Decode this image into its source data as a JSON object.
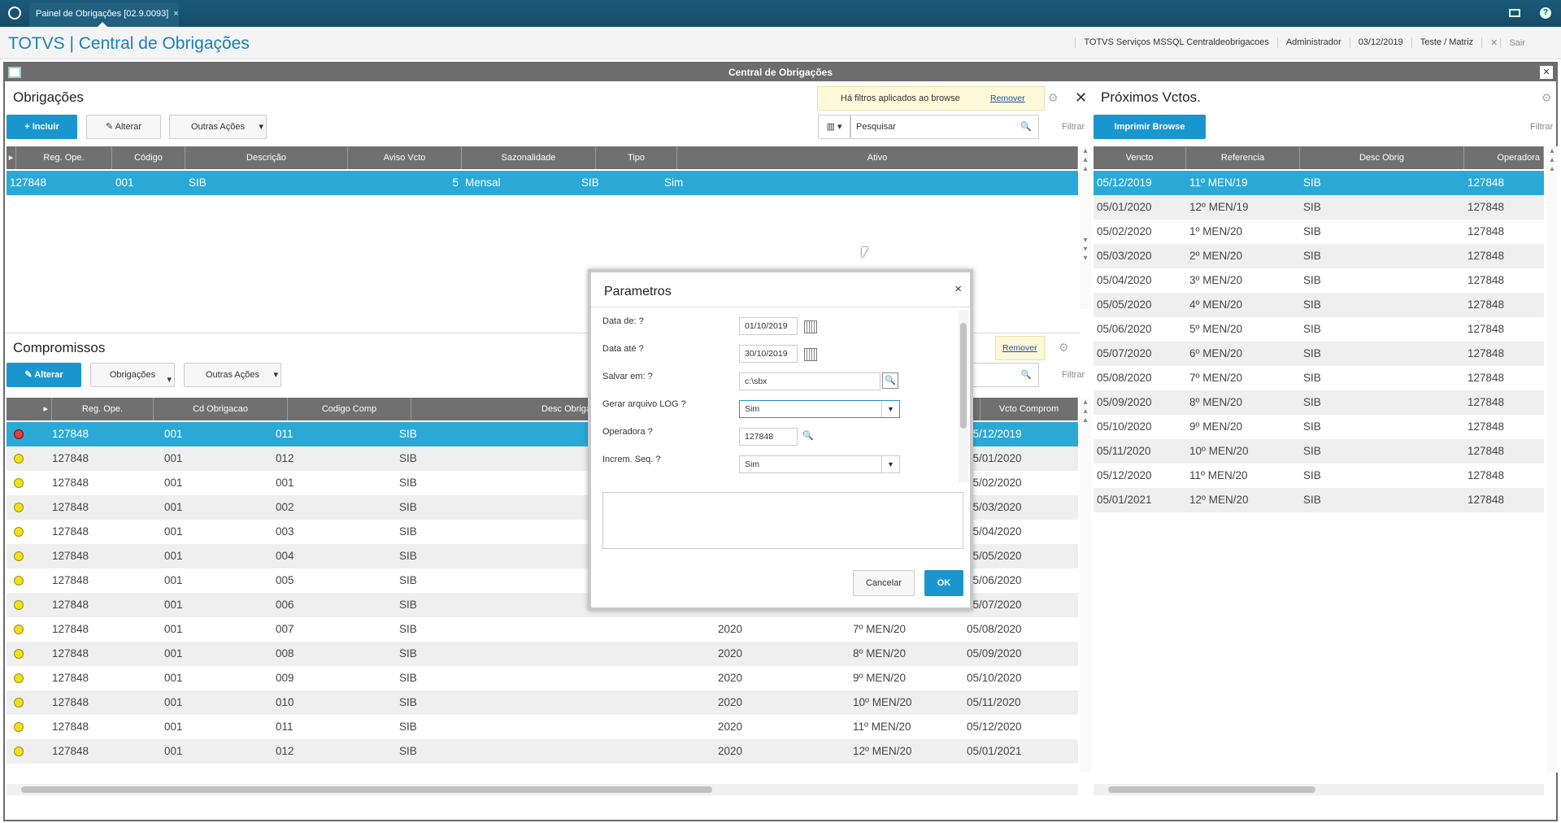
{
  "topbar": {
    "tab_label": "Painel de Obrigações [02.9.0093]",
    "tab_close": "×"
  },
  "header": {
    "app_title": "TOTVS | Central de Obrigações",
    "info": [
      "TOTVS Serviços MSSQL Centraldeobrigacoes",
      "Administrador",
      "03/12/2019",
      "Teste / Matriz"
    ],
    "exit": "Sair"
  },
  "window": {
    "title": "Central de Obrigações"
  },
  "obrigacoes": {
    "title": "Obrigações",
    "filter_msg": "Há filtros aplicados ao browse",
    "remove": "Remover",
    "btn_incluir": "Incluir",
    "btn_alterar": "Alterar",
    "btn_outras": "Outras Ações",
    "search_placeholder": "Pesquisar",
    "filtrar": "Filtrar",
    "columns": [
      "Reg. Ope.",
      "Código",
      "Descrição",
      "Aviso Vcto",
      "Sazonalidade",
      "Tipo",
      "Ativo"
    ],
    "rows": [
      [
        "127848",
        "001",
        "SIB",
        "5",
        "Mensal",
        "SIB",
        "Sim"
      ]
    ]
  },
  "compromissos": {
    "title": "Compromissos",
    "remove": "Remover",
    "btn_alterar": "Alterar",
    "btn_obrig": "Obrigações",
    "btn_outras": "Outras Ações",
    "filtrar": "Filtrar",
    "columns": [
      "Reg. Ope.",
      "Cd Obrigacao",
      "Codigo Comp",
      "Desc Obriga",
      "Vcto Comprom"
    ],
    "rows": [
      [
        "red",
        "127848",
        "001",
        "011",
        "SIB",
        "",
        "",
        "05/12/2019"
      ],
      [
        "yellow",
        "127848",
        "001",
        "012",
        "SIB",
        "",
        "",
        "05/01/2020"
      ],
      [
        "yellow",
        "127848",
        "001",
        "001",
        "SIB",
        "",
        "",
        "05/02/2020"
      ],
      [
        "yellow",
        "127848",
        "001",
        "002",
        "SIB",
        "",
        "",
        "05/03/2020"
      ],
      [
        "yellow",
        "127848",
        "001",
        "003",
        "SIB",
        "",
        "",
        "05/04/2020"
      ],
      [
        "yellow",
        "127848",
        "001",
        "004",
        "SIB",
        "",
        "",
        "05/05/2020"
      ],
      [
        "yellow",
        "127848",
        "001",
        "005",
        "SIB",
        "",
        "",
        "05/06/2020"
      ],
      [
        "yellow",
        "127848",
        "001",
        "006",
        "SIB",
        "",
        "",
        "05/07/2020"
      ],
      [
        "yellow",
        "127848",
        "001",
        "007",
        "SIB",
        "2020",
        "7º MEN/20",
        "05/08/2020"
      ],
      [
        "yellow",
        "127848",
        "001",
        "008",
        "SIB",
        "2020",
        "8º MEN/20",
        "05/09/2020"
      ],
      [
        "yellow",
        "127848",
        "001",
        "009",
        "SIB",
        "2020",
        "9º MEN/20",
        "05/10/2020"
      ],
      [
        "yellow",
        "127848",
        "001",
        "010",
        "SIB",
        "2020",
        "10º MEN/20",
        "05/11/2020"
      ],
      [
        "yellow",
        "127848",
        "001",
        "011",
        "SIB",
        "2020",
        "11º MEN/20",
        "05/12/2020"
      ],
      [
        "yellow",
        "127848",
        "001",
        "012",
        "SIB",
        "2020",
        "12º MEN/20",
        "05/01/2021"
      ]
    ]
  },
  "proximos": {
    "title": "Próximos Vctos.",
    "btn_imprimir": "Imprimir Browse",
    "filtrar": "Filtrar",
    "columns": [
      "Vencto",
      "Referencia",
      "Desc Obrig",
      "Operadora"
    ],
    "rows": [
      [
        "05/12/2019",
        "11º MEN/19",
        "SIB",
        "127848"
      ],
      [
        "05/01/2020",
        "12º MEN/19",
        "SIB",
        "127848"
      ],
      [
        "05/02/2020",
        "1º MEN/20",
        "SIB",
        "127848"
      ],
      [
        "05/03/2020",
        "2º MEN/20",
        "SIB",
        "127848"
      ],
      [
        "05/04/2020",
        "3º MEN/20",
        "SIB",
        "127848"
      ],
      [
        "05/05/2020",
        "4º MEN/20",
        "SIB",
        "127848"
      ],
      [
        "05/06/2020",
        "5º MEN/20",
        "SIB",
        "127848"
      ],
      [
        "05/07/2020",
        "6º MEN/20",
        "SIB",
        "127848"
      ],
      [
        "05/08/2020",
        "7º MEN/20",
        "SIB",
        "127848"
      ],
      [
        "05/09/2020",
        "8º MEN/20",
        "SIB",
        "127848"
      ],
      [
        "05/10/2020",
        "9º MEN/20",
        "SIB",
        "127848"
      ],
      [
        "05/11/2020",
        "10º MEN/20",
        "SIB",
        "127848"
      ],
      [
        "05/12/2020",
        "11º MEN/20",
        "SIB",
        "127848"
      ],
      [
        "05/01/2021",
        "12º MEN/20",
        "SIB",
        "127848"
      ]
    ]
  },
  "modal": {
    "title": "Parametros",
    "close": "×",
    "fields": [
      {
        "label": "Data de: ?",
        "value": "01/10/2019"
      },
      {
        "label": "Data até ?",
        "value": "30/10/2019"
      },
      {
        "label": "Salvar em: ?",
        "value": "c:\\sbx"
      },
      {
        "label": "Gerar arquivo LOG ?",
        "value": "Sim"
      },
      {
        "label": "Operadora ?",
        "value": "127848"
      },
      {
        "label": "Increm. Seq. ?",
        "value": "Sim"
      }
    ],
    "btn_cancel": "Cancelar",
    "btn_ok": "OK"
  },
  "colors": {
    "accent": "#1a96cf",
    "selected_row": "#2ba9d6",
    "header_bg": "#707070"
  }
}
